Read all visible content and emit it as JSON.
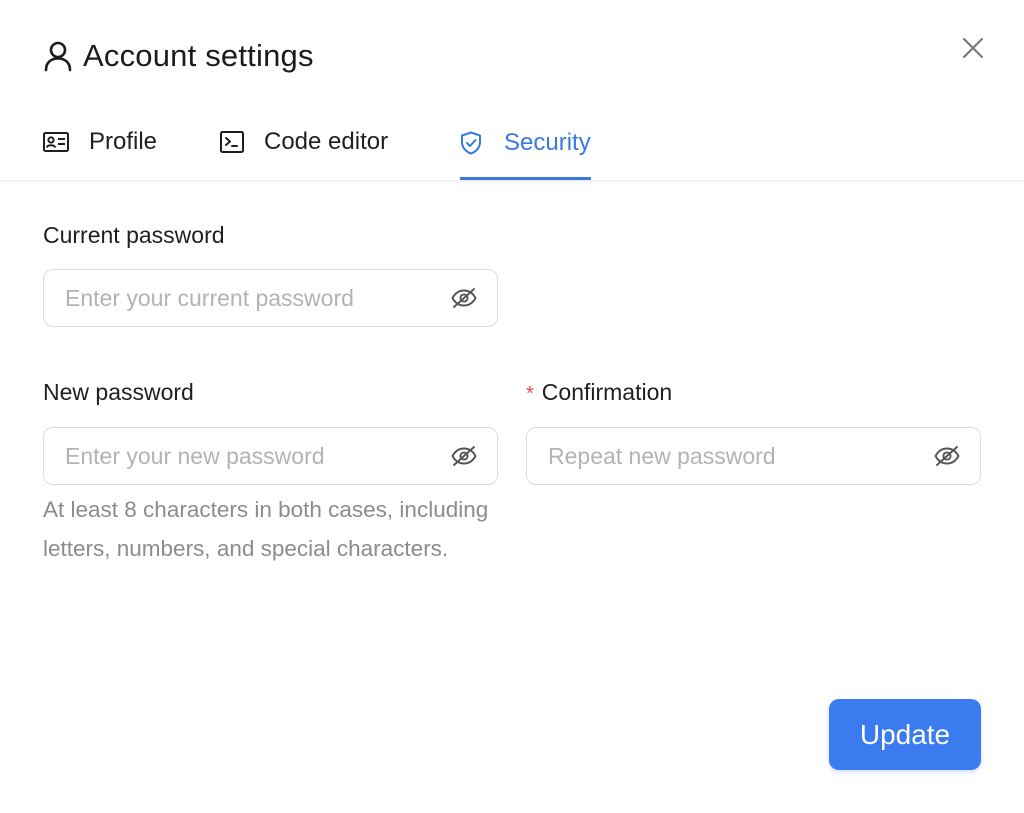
{
  "header": {
    "title": "Account settings",
    "user_icon": "user-icon",
    "close_icon": "close-icon"
  },
  "tabs": [
    {
      "label": "Profile",
      "icon": "id-card-icon",
      "active": false
    },
    {
      "label": "Code editor",
      "icon": "terminal-icon",
      "active": false
    },
    {
      "label": "Security",
      "icon": "shield-check-icon",
      "active": true
    }
  ],
  "form": {
    "current_password": {
      "label": "Current password",
      "placeholder": "Enter your current password",
      "value": ""
    },
    "new_password": {
      "label": "New password",
      "placeholder": "Enter your new password",
      "value": "",
      "hint": "At least 8 characters in both cases, including letters, numbers, and special characters."
    },
    "confirmation": {
      "required_mark": "*",
      "label": "Confirmation",
      "placeholder": "Repeat new password",
      "value": ""
    }
  },
  "actions": {
    "update_label": "Update"
  },
  "colors": {
    "accent": "#3a78e0",
    "button": "#3a7bf0",
    "required": "#e5484d",
    "hint_text": "#8c8c8c",
    "placeholder": "#b3b3b3"
  }
}
